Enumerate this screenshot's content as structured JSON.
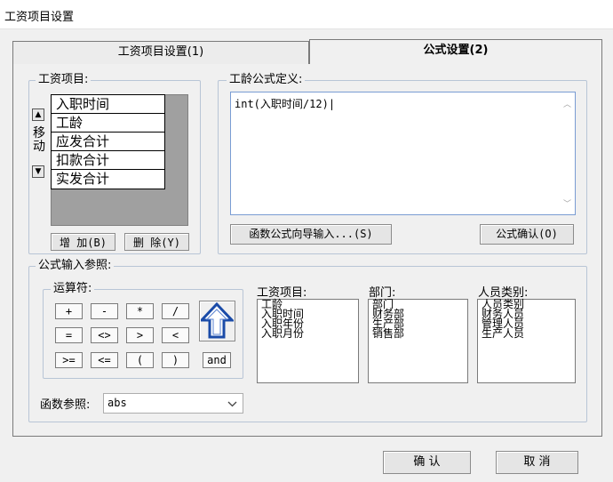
{
  "window": {
    "title": "工资项目设置"
  },
  "tabs": [
    {
      "label": "工资项目设置(1)",
      "active": false
    },
    {
      "label": "公式设置(2)",
      "active": true
    }
  ],
  "items_group": {
    "label": "工资项目:",
    "move_label": "移动",
    "items": [
      "入职时间",
      "工龄",
      "应发合计",
      "扣款合计",
      "实发合计"
    ],
    "add_button": "增 加(B)",
    "delete_button": "删 除(Y)"
  },
  "formula_group": {
    "label": "工龄公式定义:",
    "formula_text": "int(入职时间/12)",
    "wizard_button": "函数公式向导输入...(S)",
    "confirm_button": "公式确认(O)"
  },
  "reference_group": {
    "label": "公式输入参照:",
    "operators_label": "运算符:",
    "operators": [
      "+",
      "-",
      "*",
      "/",
      "=",
      "<>",
      ">",
      "<",
      ">=",
      "<=",
      "(",
      ")",
      "and"
    ],
    "salary_items_label": "工资项目:",
    "salary_items": [
      "工龄",
      "入职时间",
      "入职年份",
      "入职月份"
    ],
    "department_label": "部门:",
    "departments": [
      "部门",
      "财务部",
      "生产部",
      "销售部"
    ],
    "personnel_label": "人员类别:",
    "personnel_types": [
      "人员类别",
      "财务人员",
      "管理人员",
      "生产人员"
    ],
    "function_label": "函数参照:",
    "function_value": "abs"
  },
  "footer": {
    "ok_button": "确 认",
    "cancel_button": "取 消"
  }
}
